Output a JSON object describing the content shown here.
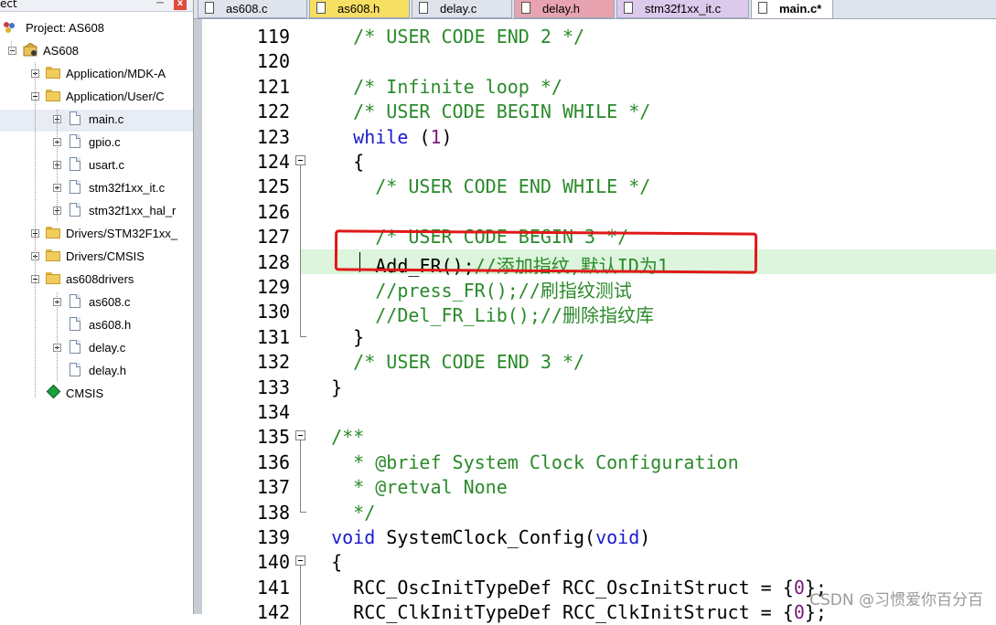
{
  "panel": {
    "title": "ect",
    "pin_glyph": "⬚",
    "close_glyph": "x",
    "tree": [
      {
        "label": "Project: AS608",
        "icon": "project-icon",
        "level": 0
      },
      {
        "label": "AS608",
        "icon": "target-icon",
        "level": 1,
        "expanded": true
      },
      {
        "label": "Application/MDK-A",
        "icon": "folder-icon",
        "level": 2,
        "expanded": false
      },
      {
        "label": "Application/User/C",
        "icon": "folder-icon",
        "level": 2,
        "expanded": true
      },
      {
        "label": "main.c",
        "icon": "file-icon",
        "level": 3,
        "expanded": false,
        "selected": true
      },
      {
        "label": "gpio.c",
        "icon": "file-icon",
        "level": 3,
        "expanded": false
      },
      {
        "label": "usart.c",
        "icon": "file-icon",
        "level": 3,
        "expanded": false
      },
      {
        "label": "stm32f1xx_it.c",
        "icon": "file-icon",
        "level": 3,
        "expanded": false
      },
      {
        "label": "stm32f1xx_hal_r",
        "icon": "file-icon",
        "level": 3,
        "expanded": false
      },
      {
        "label": "Drivers/STM32F1xx_",
        "icon": "folder-icon",
        "level": 2,
        "expanded": false
      },
      {
        "label": "Drivers/CMSIS",
        "icon": "folder-icon",
        "level": 2,
        "expanded": false
      },
      {
        "label": "as608drivers",
        "icon": "folder-icon",
        "level": 2,
        "expanded": true
      },
      {
        "label": "as608.c",
        "icon": "file-icon",
        "level": 3,
        "expanded": false
      },
      {
        "label": "as608.h",
        "icon": "file-icon",
        "level": 3
      },
      {
        "label": "delay.c",
        "icon": "file-icon",
        "level": 3,
        "expanded": false
      },
      {
        "label": "delay.h",
        "icon": "file-icon",
        "level": 3
      },
      {
        "label": "CMSIS",
        "icon": "gem-icon",
        "level": 2
      }
    ]
  },
  "tabs": [
    {
      "label": "as608.c",
      "color": "#dfe3ec",
      "active": false
    },
    {
      "label": "as608.h",
      "color": "#f6df62",
      "active": false
    },
    {
      "label": "delay.c",
      "color": "#dfe3ec",
      "active": false
    },
    {
      "label": "delay.h",
      "color": "#e8a3b0",
      "active": false
    },
    {
      "label": "stm32f1xx_it.c",
      "color": "#dcc9ec",
      "active": false
    },
    {
      "label": "main.c*",
      "color": "#ffffff",
      "active": true
    }
  ],
  "editor": {
    "lines": [
      {
        "n": "119",
        "fold": "",
        "parts": [
          [
            "    ",
            ""
          ],
          [
            "/* USER CODE END 2 */",
            "c"
          ]
        ]
      },
      {
        "n": "120",
        "fold": "",
        "parts": []
      },
      {
        "n": "121",
        "fold": "",
        "parts": [
          [
            "    ",
            ""
          ],
          [
            "/* Infinite loop */",
            "c"
          ]
        ]
      },
      {
        "n": "122",
        "fold": "",
        "parts": [
          [
            "    ",
            ""
          ],
          [
            "/* USER CODE BEGIN WHILE */",
            "c"
          ]
        ]
      },
      {
        "n": "123",
        "fold": "",
        "parts": [
          [
            "    ",
            ""
          ],
          [
            "while",
            "k"
          ],
          [
            " (",
            ""
          ],
          [
            "1",
            "n"
          ],
          [
            ")",
            ""
          ]
        ]
      },
      {
        "n": "124",
        "fold": "open",
        "parts": [
          [
            "    {",
            ""
          ]
        ]
      },
      {
        "n": "125",
        "fold": "line",
        "parts": [
          [
            "      ",
            ""
          ],
          [
            "/* USER CODE END WHILE */",
            "c"
          ]
        ]
      },
      {
        "n": "126",
        "fold": "line",
        "parts": []
      },
      {
        "n": "127",
        "fold": "line",
        "parts": [
          [
            "      ",
            ""
          ],
          [
            "/* USER CODE BEGIN 3 */",
            "c"
          ]
        ]
      },
      {
        "n": "128",
        "fold": "line",
        "highlight": true,
        "parts": [
          [
            "      Add_FR();",
            ""
          ],
          [
            "//添加指纹,默认ID为1",
            "c"
          ]
        ]
      },
      {
        "n": "129",
        "fold": "line",
        "parts": [
          [
            "      ",
            ""
          ],
          [
            "//press_FR();//刷指纹测试",
            "c"
          ]
        ]
      },
      {
        "n": "130",
        "fold": "line",
        "parts": [
          [
            "      ",
            ""
          ],
          [
            "//Del_FR_Lib();//删除指纹库",
            "c"
          ]
        ]
      },
      {
        "n": "131",
        "fold": "end",
        "parts": [
          [
            "    }",
            ""
          ]
        ]
      },
      {
        "n": "132",
        "fold": "",
        "parts": [
          [
            "    ",
            ""
          ],
          [
            "/* USER CODE END 3 */",
            "c"
          ]
        ]
      },
      {
        "n": "133",
        "fold": "",
        "parts": [
          [
            "  }",
            ""
          ]
        ]
      },
      {
        "n": "134",
        "fold": "",
        "parts": []
      },
      {
        "n": "135",
        "fold": "open",
        "parts": [
          [
            "  ",
            ""
          ],
          [
            "/**",
            "c"
          ]
        ]
      },
      {
        "n": "136",
        "fold": "line",
        "parts": [
          [
            "    ",
            ""
          ],
          [
            "* @brief System Clock Configuration",
            "c"
          ]
        ]
      },
      {
        "n": "137",
        "fold": "line",
        "parts": [
          [
            "    ",
            ""
          ],
          [
            "* @retval None",
            "c"
          ]
        ]
      },
      {
        "n": "138",
        "fold": "end",
        "parts": [
          [
            "    ",
            ""
          ],
          [
            "*/",
            "c"
          ]
        ]
      },
      {
        "n": "139",
        "fold": "",
        "parts": [
          [
            "  ",
            ""
          ],
          [
            "void",
            "k"
          ],
          [
            " SystemClock_Config(",
            ""
          ],
          [
            "void",
            "k"
          ],
          [
            ")",
            ""
          ]
        ]
      },
      {
        "n": "140",
        "fold": "open",
        "parts": [
          [
            "  {",
            ""
          ]
        ]
      },
      {
        "n": "141",
        "fold": "line",
        "parts": [
          [
            "    RCC_OscInitTypeDef RCC_OscInitStruct = {",
            ""
          ],
          [
            "0",
            "n"
          ],
          [
            "};",
            ""
          ]
        ]
      },
      {
        "n": "142",
        "fold": "line",
        "parts": [
          [
            "    RCC_ClkInitTypeDef RCC_ClkInitStruct = {",
            ""
          ],
          [
            "0",
            "n"
          ],
          [
            "};",
            ""
          ]
        ]
      }
    ]
  },
  "watermark": "CSDN @习惯爱你百分百",
  "colors": {
    "comment": "#2a8a2a",
    "keyword": "#1a1ad0",
    "number": "#7a1a7a",
    "current_line": "#dcf5dc",
    "annotation_box": "#e01818"
  }
}
